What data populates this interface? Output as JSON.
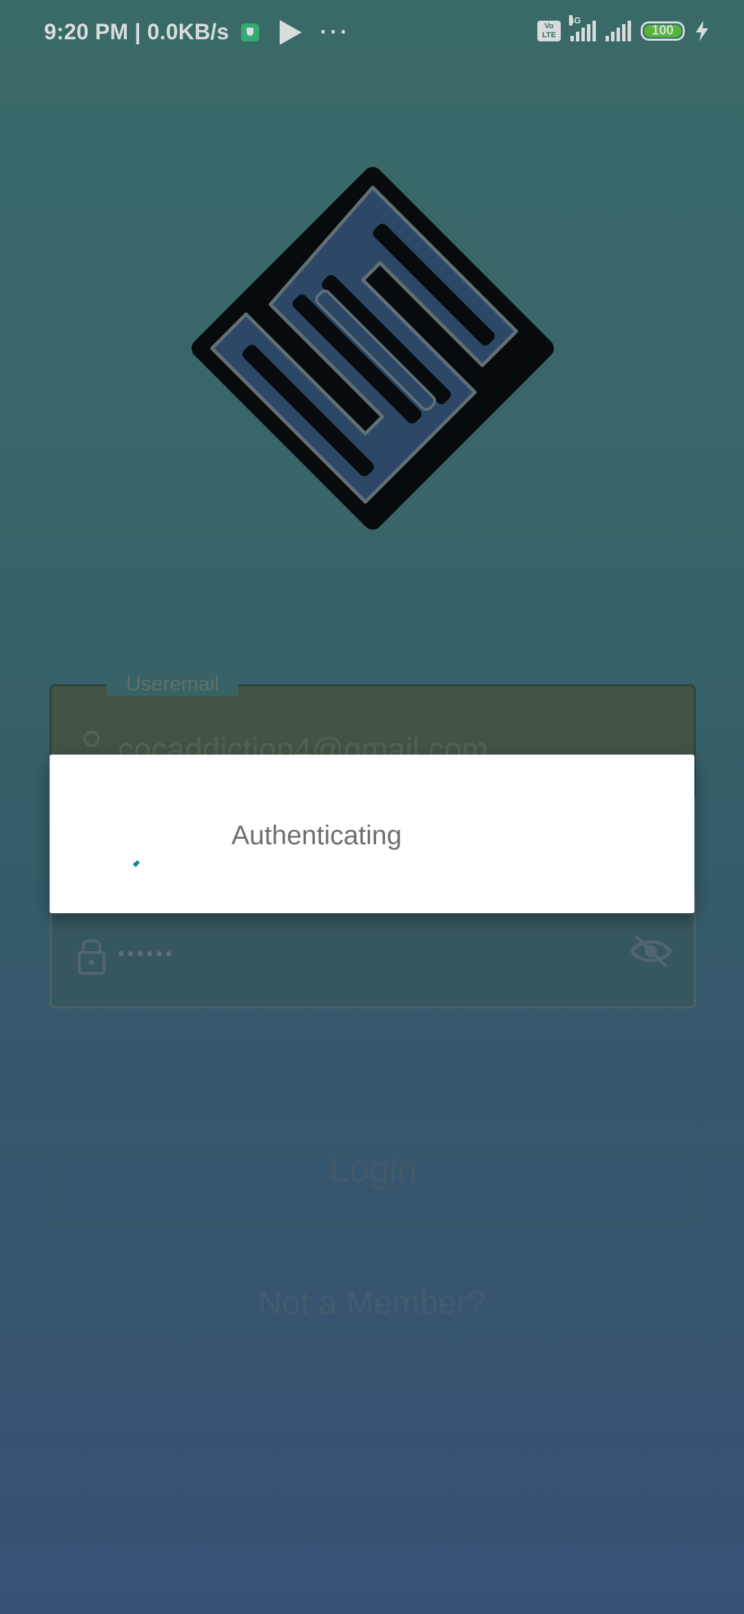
{
  "status_bar": {
    "time_speed": "9:20 PM | 0.0KB/s",
    "dots": "···",
    "volte": "Vo LTE",
    "network": "4G",
    "battery": "100"
  },
  "form": {
    "email_label": "Useremail",
    "email_value": "cocaddiction4@gmail.com",
    "password_mask": "••••••"
  },
  "actions": {
    "login_label": "Login",
    "signup_link": "Not a Member?"
  },
  "dialog": {
    "message": "Authenticating"
  },
  "colors": {
    "spinner_accent": "#128c86",
    "logo_fill": "#2f4a6e",
    "battery_green": "#5fd03b"
  }
}
